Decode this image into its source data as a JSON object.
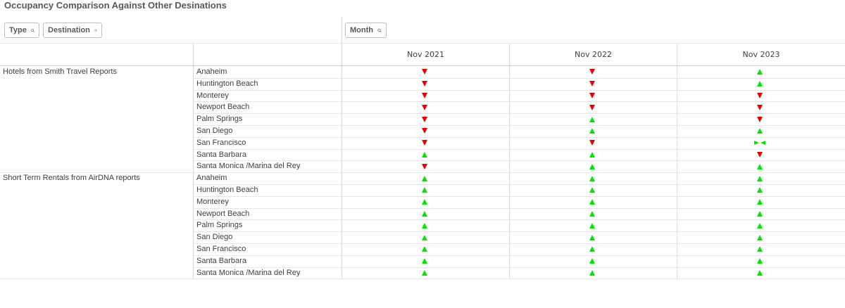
{
  "title": "Occupancy Comparison Against Other Desinations",
  "filters": {
    "type_label": "Type",
    "destination_label": "Destination",
    "month_label": "Month",
    "icon": "search-icon"
  },
  "columns": [
    "Nov 2021",
    "Nov 2022",
    "Nov 2023"
  ],
  "colors": {
    "up": "#00e600",
    "down": "#e60000",
    "border": "#d9d9d9"
  },
  "groups": [
    {
      "label": "Hotels from Smith Travel Reports",
      "rows": [
        {
          "destination": "Anaheim",
          "values": [
            "down",
            "down",
            "up"
          ]
        },
        {
          "destination": "Huntington Beach",
          "values": [
            "down",
            "down",
            "up"
          ]
        },
        {
          "destination": "Monterey",
          "values": [
            "down",
            "down",
            "down"
          ]
        },
        {
          "destination": "Newport Beach",
          "values": [
            "down",
            "down",
            "down"
          ]
        },
        {
          "destination": "Palm Springs",
          "values": [
            "down",
            "up",
            "down"
          ]
        },
        {
          "destination": "San Diego",
          "values": [
            "down",
            "up",
            "up"
          ]
        },
        {
          "destination": "San Francisco",
          "values": [
            "down",
            "down",
            "neutral"
          ]
        },
        {
          "destination": "Santa Barbara",
          "values": [
            "up",
            "up",
            "down"
          ]
        },
        {
          "destination": "Santa Monica /Marina del Rey",
          "values": [
            "down",
            "up",
            "up"
          ]
        }
      ]
    },
    {
      "label": "Short Term Rentals from AirDNA reports",
      "rows": [
        {
          "destination": "Anaheim",
          "values": [
            "up",
            "up",
            "up"
          ]
        },
        {
          "destination": "Huntington Beach",
          "values": [
            "up",
            "up",
            "up"
          ]
        },
        {
          "destination": "Monterey",
          "values": [
            "up",
            "up",
            "up"
          ]
        },
        {
          "destination": "Newport Beach",
          "values": [
            "up",
            "up",
            "up"
          ]
        },
        {
          "destination": "Palm Springs",
          "values": [
            "up",
            "up",
            "up"
          ]
        },
        {
          "destination": "San Diego",
          "values": [
            "up",
            "up",
            "up"
          ]
        },
        {
          "destination": "San Francisco",
          "values": [
            "up",
            "up",
            "up"
          ]
        },
        {
          "destination": "Santa Barbara",
          "values": [
            "up",
            "up",
            "up"
          ]
        },
        {
          "destination": "Santa Monica /Marina del Rey",
          "values": [
            "up",
            "up",
            "up"
          ]
        }
      ]
    }
  ]
}
